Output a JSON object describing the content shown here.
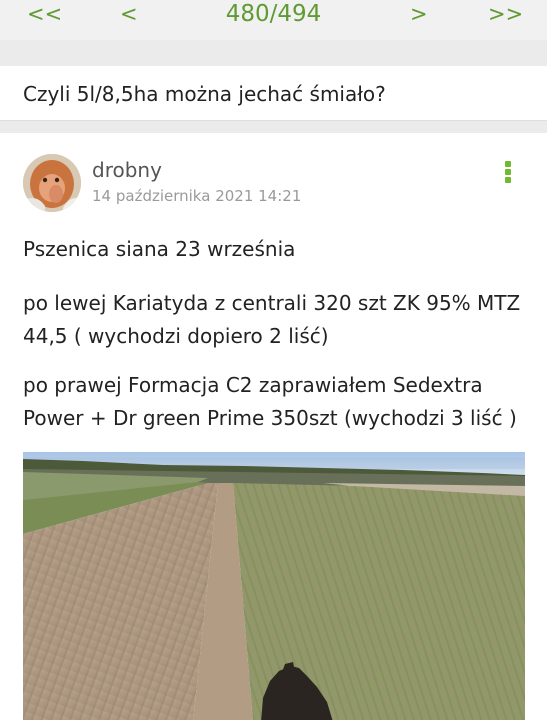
{
  "pager": {
    "first": "<<",
    "prev": "<",
    "current": "480/494",
    "next": ">",
    "last": ">>"
  },
  "quote": {
    "text": "Czyli 5l/8,5ha można jechać śmiało?"
  },
  "post": {
    "author": "drobny",
    "date": "14 października 2021 14:21",
    "paragraphs": [
      "Pszenica siana 23 września",
      "po lewej Kariatyda z centrali 320 szt ZK 95% MTZ 44,5 ( wychodzi dopiero 2 liść)",
      "po prawej Formacja C2 zaprawiałem Sedextra Power + Dr green Prime 350szt (wychodzi 3 liść )"
    ],
    "menu_icon": "vertical-dots-icon"
  },
  "colors": {
    "accent": "#72b830",
    "pager_text": "#5f9a33",
    "background": "#ebebeb"
  }
}
